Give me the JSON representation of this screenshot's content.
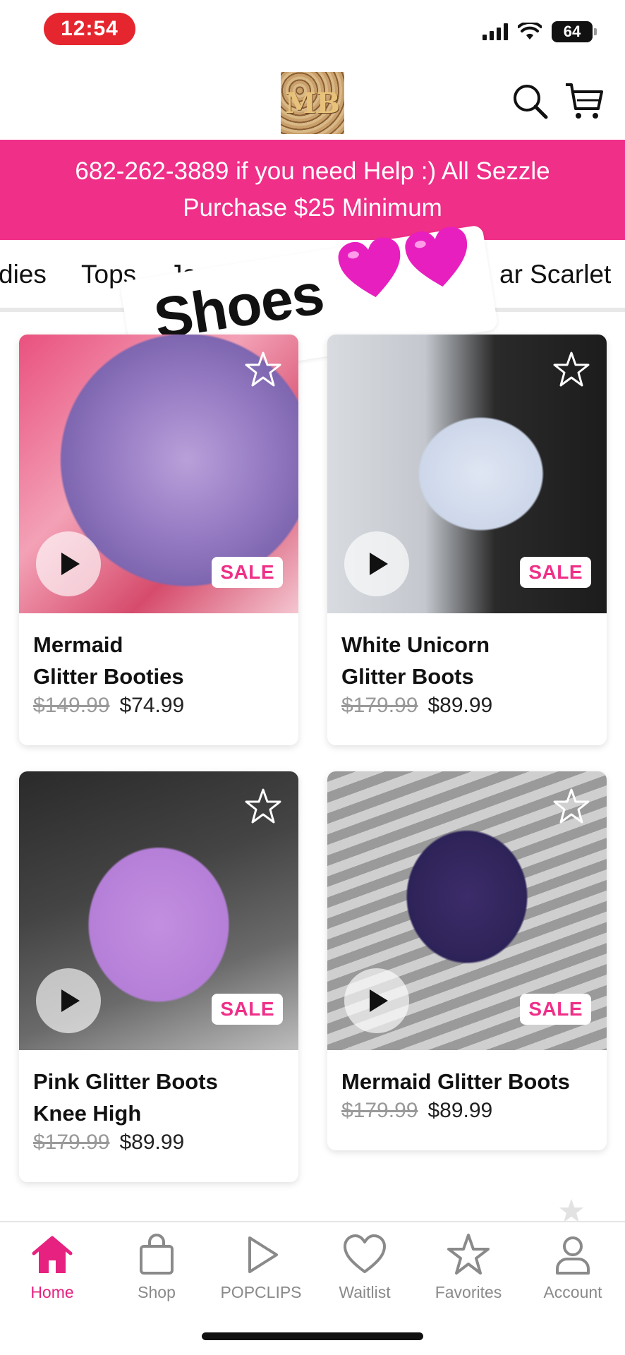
{
  "status_bar": {
    "time": "12:54",
    "battery": "64"
  },
  "header": {
    "logo_text": "MB"
  },
  "promo": {
    "text": "682-262-3889 if  you need Help :) All Sezzle Purchase $25 Minimum"
  },
  "categories": [
    "dies",
    "Tops",
    "Jean",
    "ar Scarlet"
  ],
  "overlay": {
    "sticker_text": "Shoes",
    "emoji": "💗💗"
  },
  "products": [
    {
      "name_line1": "Mermaid",
      "name_line2": "Glitter Booties",
      "old_price": "$149.99",
      "price": "$74.99",
      "badge": "SALE"
    },
    {
      "name_line1": "White Unicorn",
      "name_line2": "Glitter Boots",
      "old_price": "$179.99",
      "price": "$89.99",
      "badge": "SALE"
    },
    {
      "name_line1": "Pink Glitter Boots",
      "name_line2": "Knee High",
      "old_price": "$179.99",
      "price": "$89.99",
      "badge": "SALE"
    },
    {
      "name_line1": "Mermaid Glitter Boots",
      "name_line2": "",
      "old_price": "$179.99",
      "price": "$89.99",
      "badge": "SALE"
    }
  ],
  "nav": [
    {
      "label": "Home",
      "icon": "home-icon",
      "active": true
    },
    {
      "label": "Shop",
      "icon": "bag-icon"
    },
    {
      "label": "POPCLIPS",
      "icon": "play-icon"
    },
    {
      "label": "Waitlist",
      "icon": "heart-icon"
    },
    {
      "label": "Favorites",
      "icon": "star-icon"
    },
    {
      "label": "Account",
      "icon": "person-icon"
    }
  ],
  "colors": {
    "brand_pink": "#ef2f88",
    "active_nav": "#e6217f",
    "sale_text": "#ef2f88"
  }
}
